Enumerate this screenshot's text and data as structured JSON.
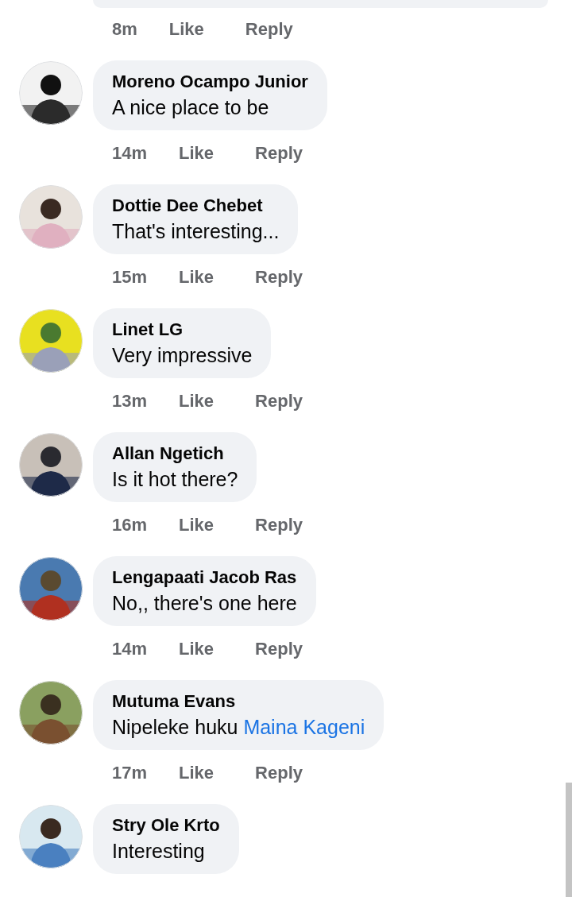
{
  "previous_comment": {
    "time": "8m",
    "like": "Like",
    "reply": "Reply"
  },
  "comments": [
    {
      "author": "Moreno Ocampo Junior",
      "text": "A nice place to be",
      "time": "14m",
      "like": "Like",
      "reply": "Reply"
    },
    {
      "author": "Dottie Dee Chebet",
      "text": "That's interesting...",
      "time": "15m",
      "like": "Like",
      "reply": "Reply"
    },
    {
      "author": "Linet LG",
      "text": "Very impressive",
      "time": "13m",
      "like": "Like",
      "reply": "Reply"
    },
    {
      "author": "Allan Ngetich",
      "text": "Is it hot there?",
      "time": "16m",
      "like": "Like",
      "reply": "Reply"
    },
    {
      "author": "Lengapaati Jacob Ras",
      "text": "No,, there's one here",
      "time": "14m",
      "like": "Like",
      "reply": "Reply"
    },
    {
      "author": "Mutuma Evans",
      "text": "Nipeleke huku",
      "mention": "Maina Kageni",
      "time": "17m",
      "like": "Like",
      "reply": "Reply"
    },
    {
      "author": "Stry Ole Krto",
      "text": "Interesting"
    }
  ]
}
